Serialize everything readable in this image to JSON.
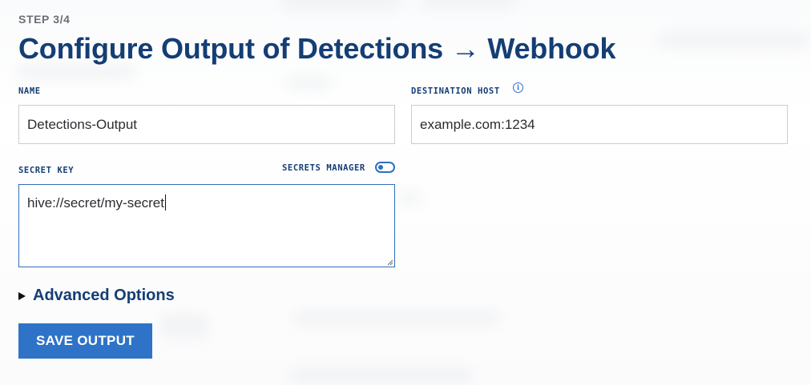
{
  "step_label": "STEP 3/4",
  "page_title": "Configure Output of Detections → Webhook",
  "fields": {
    "name": {
      "label": "NAME",
      "value": "Detections-Output"
    },
    "destination_host": {
      "label": "DESTINATION HOST",
      "value": "example.com:1234",
      "info_icon": "info-icon"
    },
    "secret_key": {
      "label": "SECRET KEY",
      "value": "hive://secret/my-secret"
    }
  },
  "secrets_manager": {
    "label": "SECRETS MANAGER",
    "enabled": false
  },
  "advanced_options": {
    "label": "Advanced Options",
    "icon": "disclosure-triangle-right-icon"
  },
  "save_button": {
    "label": "SAVE OUTPUT"
  },
  "colors": {
    "heading": "#143e74",
    "accent": "#2e73c7",
    "step_label": "#6b6f76",
    "input_border": "#c9cdd2",
    "focus_border": "#2f6fbd"
  }
}
